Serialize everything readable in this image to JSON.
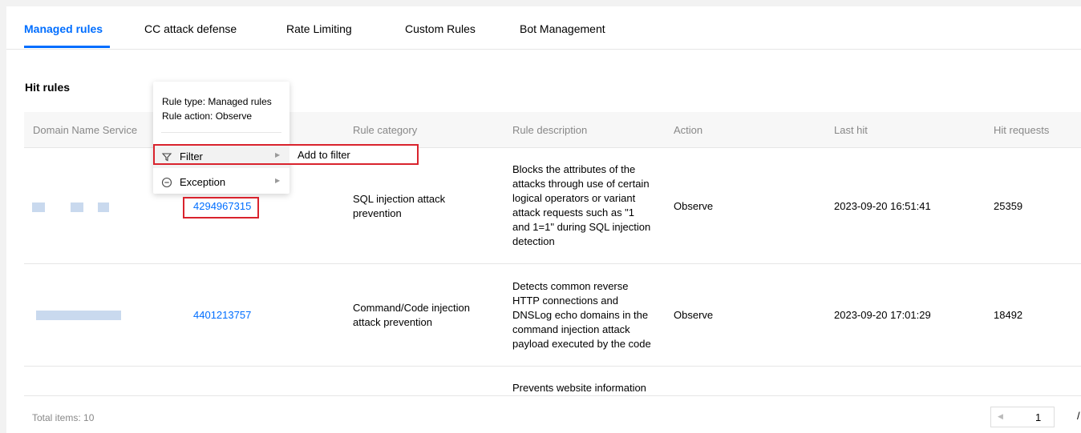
{
  "tabs": [
    {
      "label": "Managed rules",
      "active": true
    },
    {
      "label": "CC attack defense",
      "active": false
    },
    {
      "label": "Rate Limiting",
      "active": false
    },
    {
      "label": "Custom Rules",
      "active": false
    },
    {
      "label": "Bot Management",
      "active": false
    }
  ],
  "section_title": "Hit rules",
  "table": {
    "columns": [
      "Domain Name Service",
      "Rule category",
      "Rule description",
      "Action",
      "Last hit",
      "Hit requests"
    ],
    "rows": [
      {
        "rule_id": "4294967315",
        "rule_category": [
          "SQL injection attack",
          "prevention"
        ],
        "rule_description": [
          "Blocks the attributes of the",
          "attacks through use of certain",
          "logical operators or variant",
          "attack requests such as \"1",
          "and 1=1\" during SQL injection",
          "detection"
        ],
        "action": "Observe",
        "last_hit": "2023-09-20 16:51:41",
        "hit_requests": "25359"
      },
      {
        "rule_id": "4401213757",
        "rule_category": [
          "Command/Code injection",
          "attack prevention"
        ],
        "rule_description": [
          "Detects common reverse",
          "HTTP connections and",
          "DNSLog echo domains in the",
          "command injection attack",
          "payload executed by the code"
        ],
        "action": "Observe",
        "last_hit": "2023-09-20 17:01:29",
        "hit_requests": "18492"
      },
      {
        "rule_description": [
          "Prevents website information"
        ]
      }
    ]
  },
  "footer": {
    "total": "Total items: 10",
    "page": "1",
    "page_sep": "/"
  },
  "context_menu": {
    "info": [
      "Rule type: Managed rules",
      "Rule action: Observe"
    ],
    "items": [
      {
        "label": "Filter",
        "icon": "filter-icon"
      },
      {
        "label": "Exception",
        "icon": "minus-circle-icon"
      }
    ],
    "submenu": {
      "label": "Add to filter"
    }
  },
  "colors": {
    "accent": "#006eff",
    "highlight": "#d9232d"
  }
}
